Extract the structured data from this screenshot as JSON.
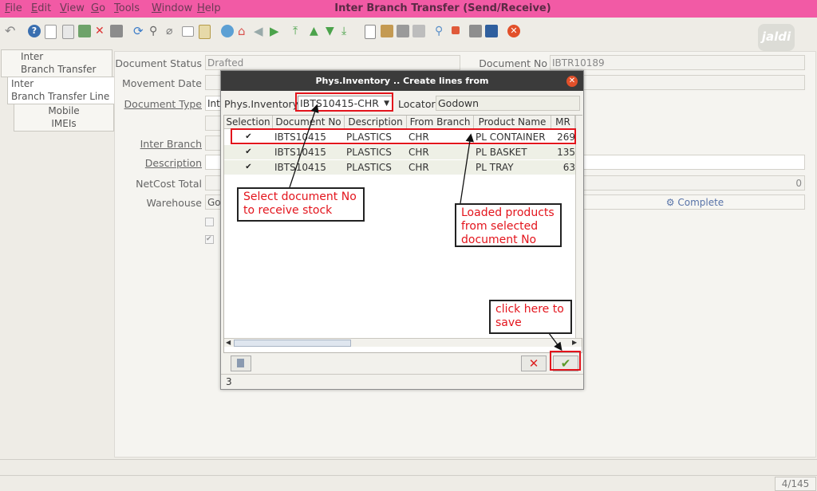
{
  "menu": {
    "file": "File",
    "edit": "Edit",
    "view": "View",
    "go": "Go",
    "tools": "Tools",
    "window": "Window",
    "help": "Help"
  },
  "window_title": "Inter Branch Transfer (Send/Receive)",
  "logo_text": "jaldi",
  "left_tabs": {
    "tab1_line1": "Inter",
    "tab1_line2": "Branch Transfer",
    "tab2_line1": "Inter",
    "tab2_line2": "Branch Transfer Line",
    "tab3_line1": "Mobile",
    "tab3_line2": "IMEIs"
  },
  "form": {
    "document_status_label": "Document Status",
    "document_status_value": "Drafted",
    "document_no_label": "Document No",
    "document_no_value": "IBTR10189",
    "movement_date_label": "Movement Date",
    "document_type_label": "Document Type",
    "document_type_value": "Inte",
    "inter_branch_label": "Inter Branch",
    "description_label": "Description",
    "netcost_total_label": "NetCost Total",
    "netcost_total_value": "0",
    "warehouse_label": "Warehouse",
    "warehouse_value": "God",
    "complete_button": "Complete"
  },
  "dialog": {
    "title": "Phys.Inventory .. Create lines from",
    "phys_inventory_label": "Phys.Inventory",
    "phys_inventory_value": "IBTS10415-CHR",
    "locator_label": "Locator",
    "locator_value": "Godown",
    "columns": [
      "Selection",
      "Document No",
      "Description",
      "From Branch",
      "Product Name",
      "MR"
    ],
    "rows": [
      {
        "document_no": "IBTS10415",
        "description": "PLASTICS",
        "from_branch": "CHR",
        "product_name": "PL CONTAINER",
        "mr": "269"
      },
      {
        "document_no": "IBTS10415",
        "description": "PLASTICS",
        "from_branch": "CHR",
        "product_name": "PL BASKET",
        "mr": "135"
      },
      {
        "document_no": "IBTS10415",
        "description": "PLASTICS",
        "from_branch": "CHR",
        "product_name": "PL TRAY",
        "mr": "63"
      }
    ],
    "status_count": "3"
  },
  "annotations": {
    "select_doc": "Select document No to receive stock",
    "loaded_products": "Loaded products from selected document No",
    "click_save": "click here to save"
  },
  "statusbar": {
    "record_count": "4/145"
  },
  "colors": {
    "title_bar": "#f25aa5",
    "annotation_red": "#e3141c",
    "dialog_header": "#3b3b3b"
  }
}
